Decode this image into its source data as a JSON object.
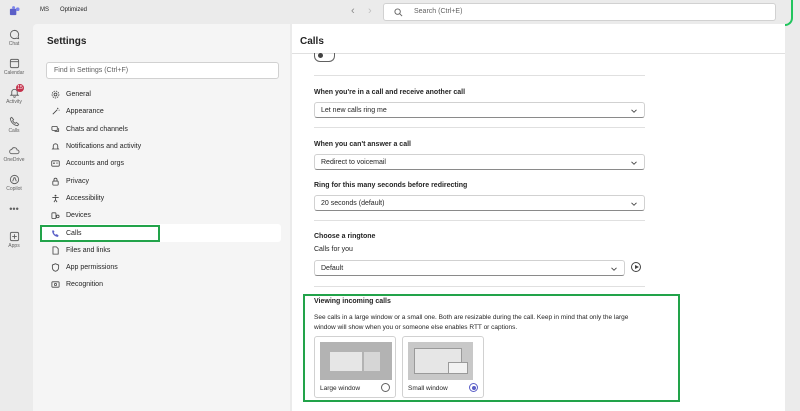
{
  "titlebar": {
    "initials": "MS",
    "org": "Optimized",
    "search_placeholder": "Search (Ctrl+E)"
  },
  "rail": {
    "items": [
      {
        "label": "Chat",
        "icon": "chat-icon"
      },
      {
        "label": "Calendar",
        "icon": "calendar-icon"
      },
      {
        "label": "Activity",
        "icon": "bell-icon",
        "badge": "15"
      },
      {
        "label": "Calls",
        "icon": "phone-icon"
      },
      {
        "label": "OneDrive",
        "icon": "cloud-icon"
      },
      {
        "label": "Copilot",
        "icon": "copilot-icon"
      },
      {
        "label": "Apps",
        "icon": "plus-square-icon"
      }
    ],
    "more": "•••"
  },
  "settings": {
    "title": "Settings",
    "search_placeholder": "Find in Settings (Ctrl+F)",
    "menu": [
      {
        "label": "General",
        "icon": "gear-icon"
      },
      {
        "label": "Appearance",
        "icon": "wand-icon"
      },
      {
        "label": "Chats and channels",
        "icon": "chat-bubbles-icon"
      },
      {
        "label": "Notifications and activity",
        "icon": "bell-icon"
      },
      {
        "label": "Accounts and orgs",
        "icon": "id-card-icon"
      },
      {
        "label": "Privacy",
        "icon": "lock-icon"
      },
      {
        "label": "Accessibility",
        "icon": "accessibility-icon"
      },
      {
        "label": "Devices",
        "icon": "devices-icon"
      },
      {
        "label": "Calls",
        "icon": "phone-icon",
        "active": true
      },
      {
        "label": "Files and links",
        "icon": "file-icon"
      },
      {
        "label": "App permissions",
        "icon": "shield-icon"
      },
      {
        "label": "Recognition",
        "icon": "recognition-icon"
      }
    ]
  },
  "main": {
    "title": "Calls",
    "in_call": {
      "heading": "When you're in a call and receive another call",
      "value": "Let new calls ring me"
    },
    "cant_answer": {
      "heading": "When you can't answer a call",
      "value": "Redirect to voicemail"
    },
    "ring_seconds": {
      "heading": "Ring for this many seconds before redirecting",
      "value": "20 seconds (default)"
    },
    "ringtone": {
      "heading": "Choose a ringtone",
      "sublabel": "Calls for you",
      "value": "Default"
    },
    "incoming": {
      "heading": "Viewing incoming calls",
      "description": "See calls in a large window or a small one. Both are resizable during the call. Keep in mind that only the large window will show when you or someone else enables RTT or captions.",
      "large_label": "Large window",
      "small_label": "Small window",
      "selected": "small"
    }
  },
  "colors": {
    "accent": "#5b5fc7",
    "highlight_green": "#22a34a",
    "badge_red": "#c4314b"
  }
}
